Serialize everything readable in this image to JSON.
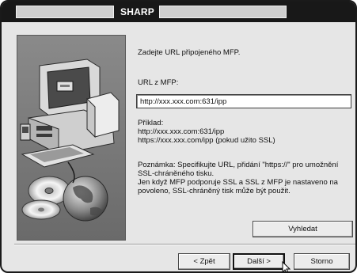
{
  "window": {
    "title": "SHARP"
  },
  "content": {
    "prompt": "Zadejte URL připojeného MFP.",
    "url_label": "URL z MFP:",
    "url_value": "http://xxx.xxx.com:631/ipp",
    "example_lines": [
      "Příklad:",
      "http://xxx.xxx.com:631/ipp",
      "https://xxx.xxx.com/ipp (pokud užito SSL)"
    ],
    "note_lines": [
      "Poznámka: Specifikujte URL, přidání \"https://\" pro umožnění",
      "SSL-chráněného tisku.",
      "Jen když MFP podporuje SSL a SSL z MFP je nastaveno na",
      "povoleno, SSL-chráněný tisk může být použit."
    ]
  },
  "buttons": {
    "search": "Vyhledat",
    "back": "< Zpět",
    "next": "Další >",
    "cancel": "Storno"
  }
}
